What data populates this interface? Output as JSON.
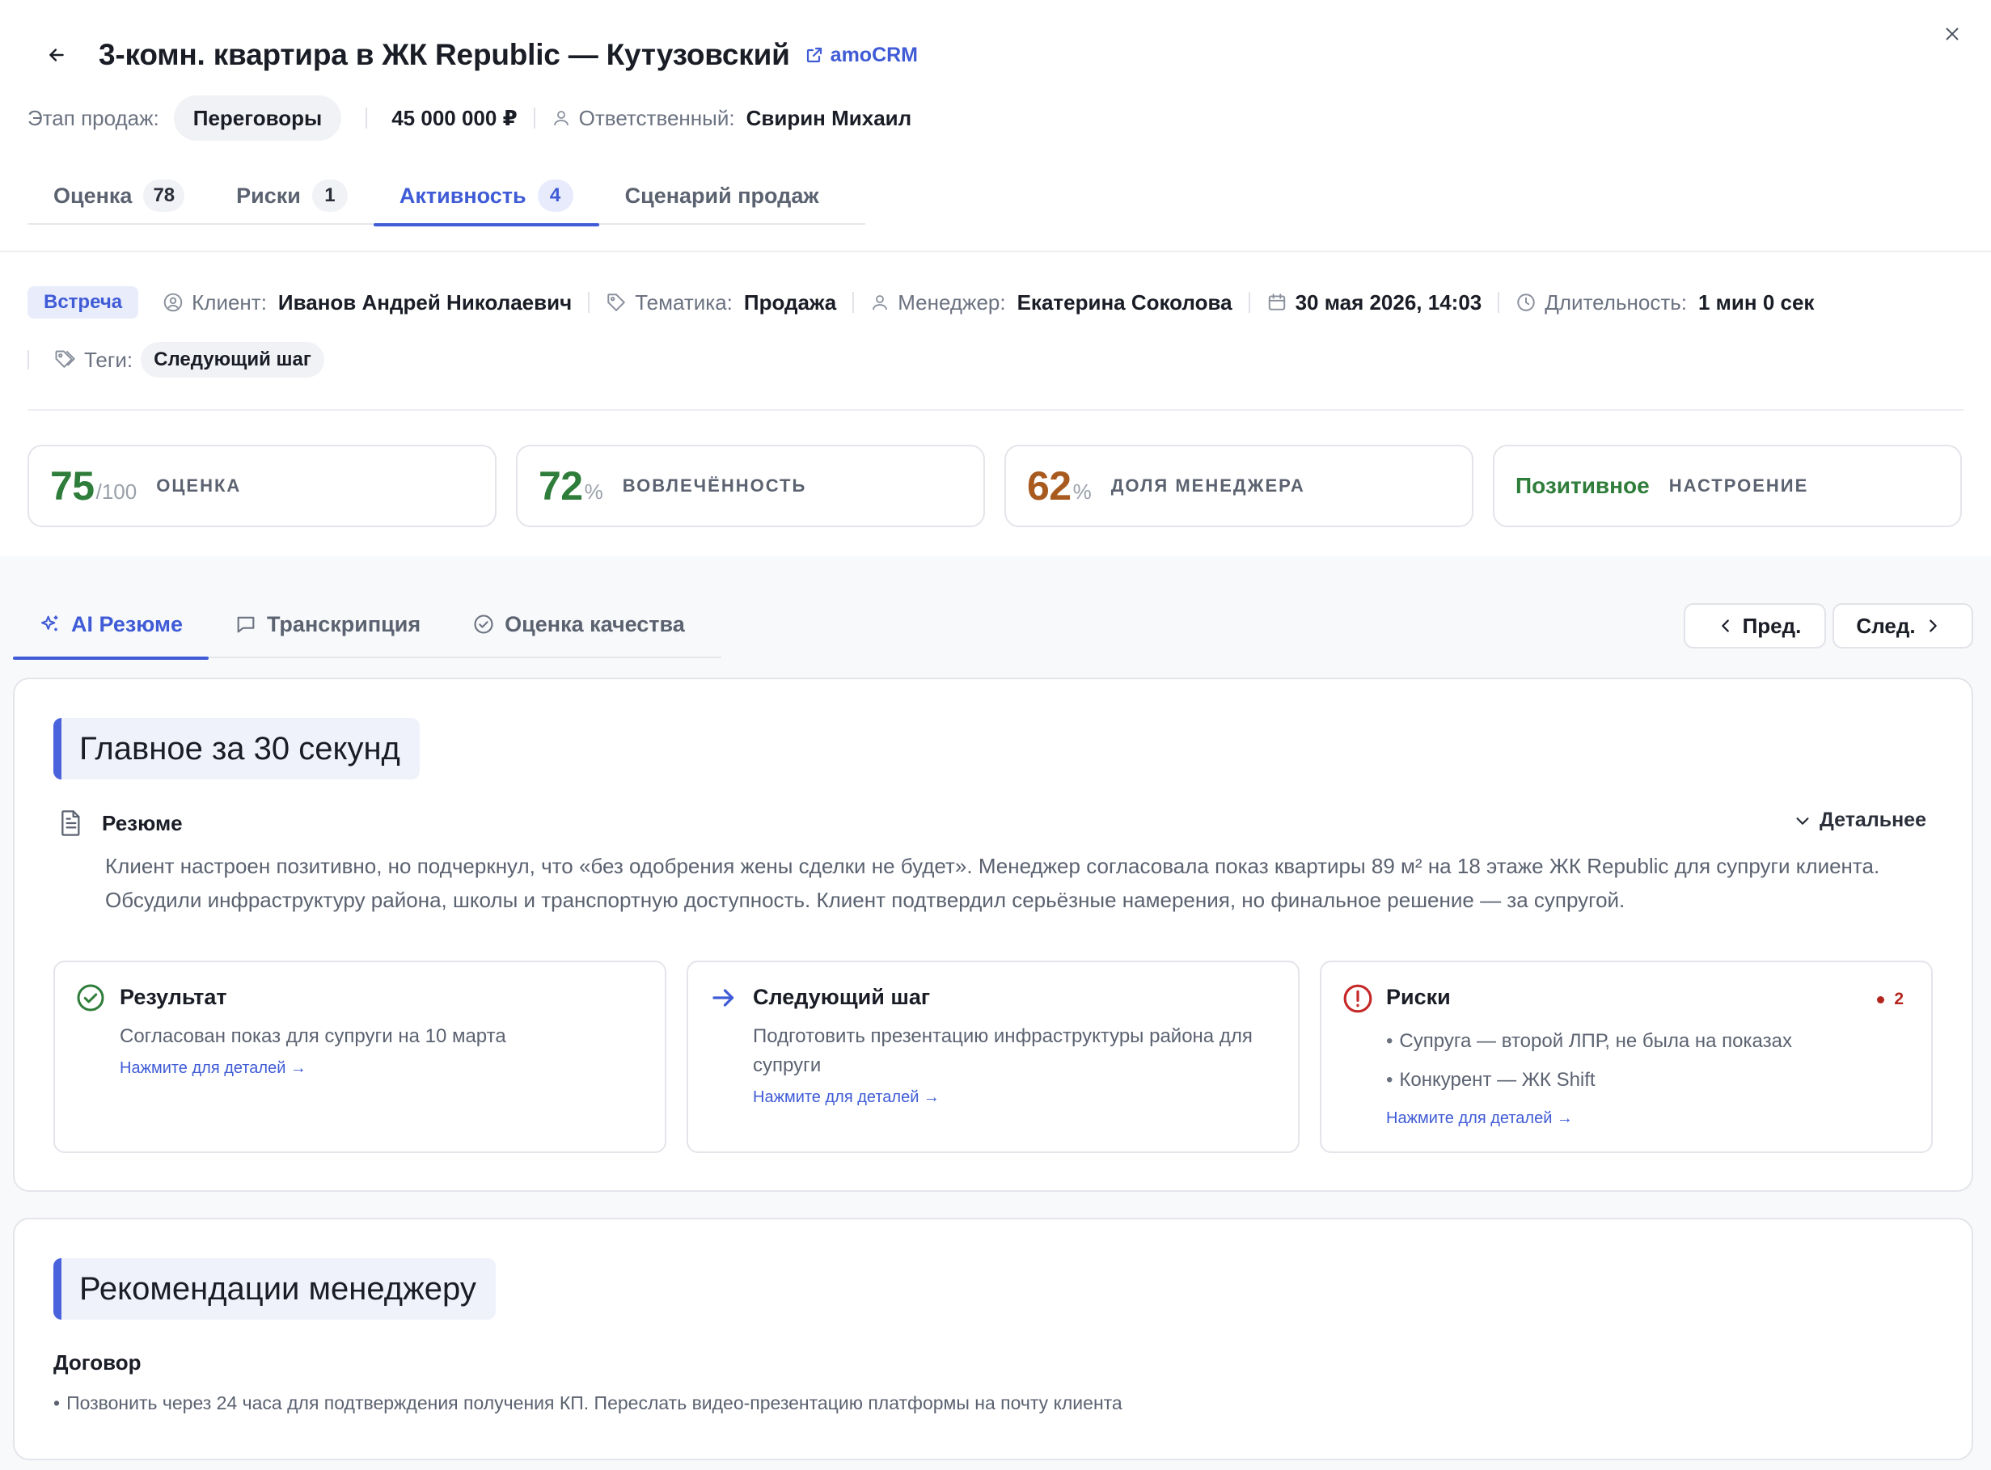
{
  "header": {
    "title": "3-комн. квартира в ЖК Republic — Кутузовский",
    "crm_link": "amoCRM"
  },
  "deal": {
    "stage_label": "Этап продаж:",
    "stage_value": "Переговоры",
    "amount": "45 000 000 ₽",
    "owner_label": "Ответственный:",
    "owner_value": "Свирин Михаил"
  },
  "top_tabs": [
    {
      "label": "Оценка",
      "count": "78",
      "active": false
    },
    {
      "label": "Риски",
      "count": "1",
      "active": false
    },
    {
      "label": "Активность",
      "count": "4",
      "active": true
    },
    {
      "label": "Сценарий продаж",
      "count": "",
      "active": false
    }
  ],
  "meeting": {
    "type": "Встреча",
    "client_label": "Клиент:",
    "client_value": "Иванов Андрей Николаевич",
    "topic_label": "Тематика:",
    "topic_value": "Продажа",
    "manager_label": "Менеджер:",
    "manager_value": "Екатерина Соколова",
    "datetime": "30 мая 2026, 14:03",
    "duration_label": "Длительность:",
    "duration_value": "1 мин 0 сек",
    "tags_label": "Теги:",
    "tag": "Следующий шаг"
  },
  "kpis": {
    "score": {
      "value": "75",
      "suffix": "/100",
      "label": "ОЦЕНКА",
      "color": "#2f7d3a"
    },
    "engagement": {
      "value": "72",
      "suffix": "%",
      "label": "ВОВЛЕЧЁННОСТЬ",
      "color": "#2f7d3a"
    },
    "manager_share": {
      "value": "62",
      "suffix": "%",
      "label": "ДОЛЯ МЕНЕДЖЕРА",
      "color": "#a95a1f"
    },
    "mood": {
      "value": "Позитивное",
      "label": "НАСТРОЕНИЕ",
      "color": "#2f7d3a"
    }
  },
  "bottom_tabs": [
    {
      "label": "AI Резюме",
      "icon": "sparkles-icon",
      "active": true
    },
    {
      "label": "Транскрипция",
      "icon": "chat-icon",
      "active": false
    },
    {
      "label": "Оценка качества",
      "icon": "check-circle-icon",
      "active": false
    }
  ],
  "nav": {
    "prev": "Пред.",
    "next": "След."
  },
  "summary": {
    "title": "Главное за 30 секунд",
    "resume_label": "Резюме",
    "detail_toggle": "Детальнее",
    "resume_text": "Клиент настроен позитивно, но подчеркнул, что «без одобрения жены сделки не будет». Менеджер согласовала показ квартиры 89 м² на 18 этаже ЖК Republic для супруги клиента. Обсудили инфраструктуру района, школы и транспортную доступность. Клиент подтвердил серьёзные намерения, но финальное решение — за супругой.",
    "result": {
      "title": "Результат",
      "text": "Согласован показ для супруги на 10 марта",
      "link": "Нажмите для деталей →"
    },
    "next_step": {
      "title": "Следующий шаг",
      "text": "Подготовить презентацию инфраструктуры района для супруги",
      "link": "Нажмите для деталей →"
    },
    "risks": {
      "title": "Риски",
      "count": "2",
      "items": [
        "Супруга — второй ЛПР, не была на показах",
        "Конкурент — ЖК Shift"
      ],
      "link": "Нажмите для деталей →"
    }
  },
  "recommendations": {
    "title": "Рекомендации менеджеру",
    "subtitle": "Договор",
    "text": "Позвонить через 24 часа для подтверждения получения КП. Переслать видео-презентацию платформы на почту клиента"
  },
  "colors": {
    "accent": "#3f5bd6",
    "positive": "#2f7d3a",
    "warning": "#a95a1f",
    "danger": "#b3261e"
  }
}
